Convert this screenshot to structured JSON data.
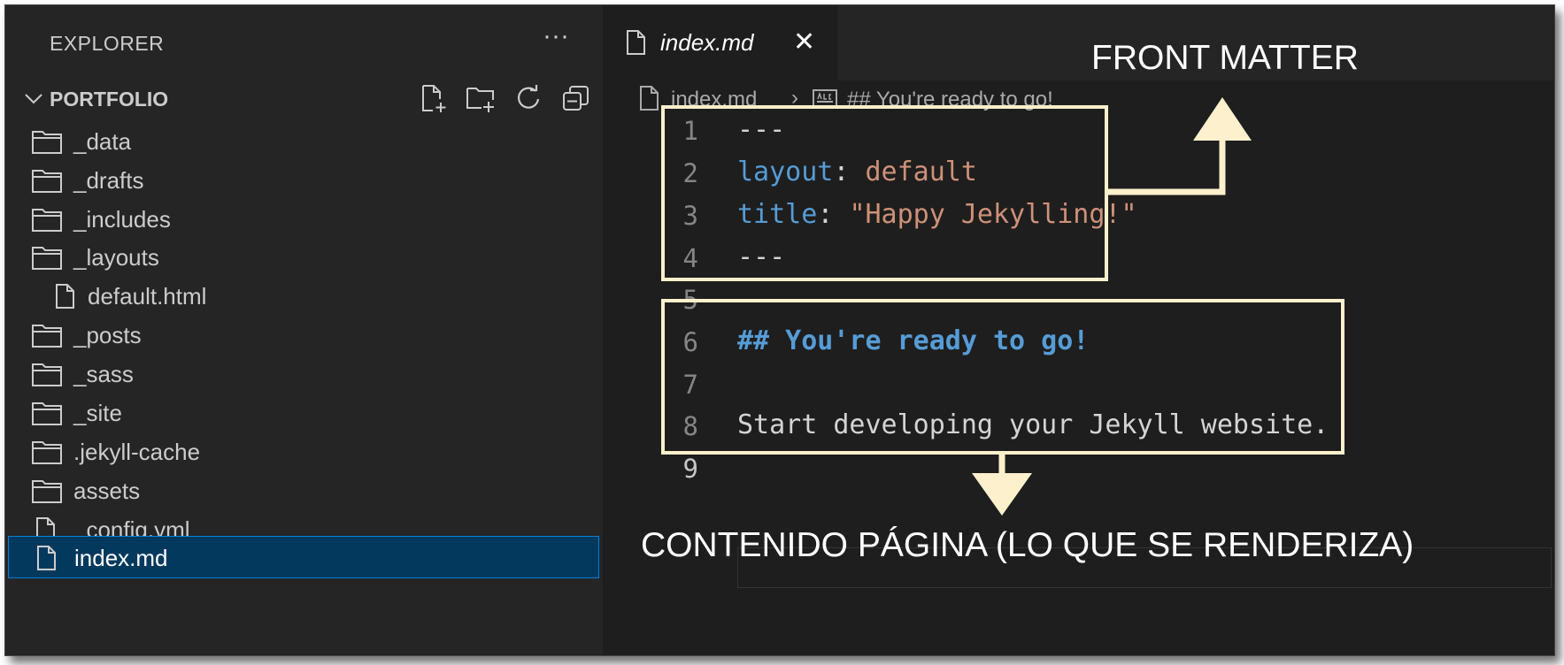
{
  "sidebar": {
    "title": "EXPLORER",
    "more": "···",
    "project": "PORTFOLIO",
    "items": [
      {
        "label": "_data",
        "type": "folder"
      },
      {
        "label": "_drafts",
        "type": "folder"
      },
      {
        "label": "_includes",
        "type": "folder"
      },
      {
        "label": "_layouts",
        "type": "folder"
      },
      {
        "label": "default.html",
        "type": "file"
      },
      {
        "label": "_posts",
        "type": "folder"
      },
      {
        "label": "_sass",
        "type": "folder"
      },
      {
        "label": "_site",
        "type": "folder"
      },
      {
        "label": ".jekyll-cache",
        "type": "folder"
      },
      {
        "label": "assets",
        "type": "folder"
      },
      {
        "label": "_config.yml",
        "type": "file"
      },
      {
        "label": "index.md",
        "type": "file"
      }
    ],
    "selected": "index.md"
  },
  "editor": {
    "tab_label": "index.md",
    "close": "✕",
    "breadcrumb": {
      "file": "index.md",
      "sep": "›",
      "symbol": "## You're ready to go!"
    },
    "line_numbers": [
      "1",
      "2",
      "3",
      "4",
      "5",
      "6",
      "7",
      "8",
      "9"
    ],
    "lines": {
      "l1": "---",
      "l2_key": "layout",
      "l2_colon": ": ",
      "l2_val": "default",
      "l3_key": "title",
      "l3_colon": ": ",
      "l3_val": "\"Happy Jekylling!\"",
      "l4": "---",
      "l6": "## You're ready to go!",
      "l8": "Start developing your Jekyll website."
    }
  },
  "annotations": {
    "front_matter": "FRONT MATTER",
    "content": "CONTENIDO PÁGINA (LO QUE SE RENDERIZA)",
    "color": "#fdf0cc"
  },
  "colors": {
    "sidebar_bg": "#252526",
    "editor_bg": "#1e1e1e",
    "selection_bg": "#04395e",
    "keyword": "#569cd6",
    "string": "#ce9178"
  }
}
